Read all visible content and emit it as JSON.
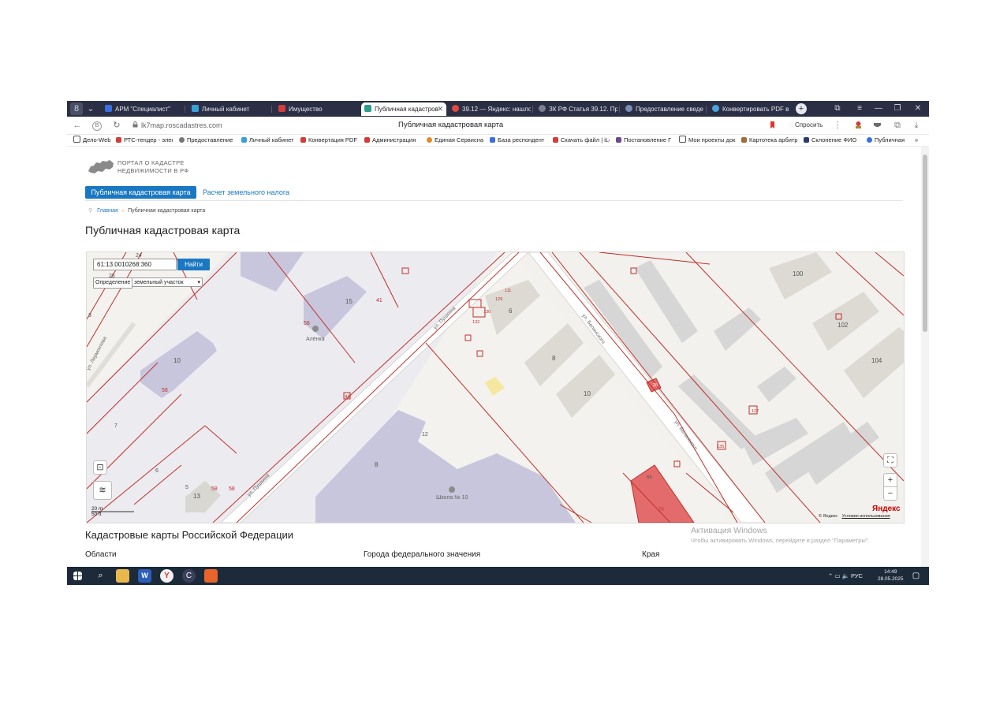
{
  "browser": {
    "tabs": [
      {
        "label": "АРМ \"Специалист\"",
        "color": "#3b6fe0"
      },
      {
        "label": "Личный кабинет",
        "color": "#3aa0d8"
      },
      {
        "label": "Имущество",
        "color": "#d23c3c"
      },
      {
        "label": "Публичная кадастров",
        "color": "#2a9d8f"
      },
      {
        "label": "39.12 — Яндекс: нашло",
        "color": "#e04b3b"
      },
      {
        "label": "ЗК РФ Статья 39.12. Про",
        "color": "#7a7f90"
      },
      {
        "label": "Предоставление сведе",
        "color": "#7a8bb5"
      },
      {
        "label": "Конвертировать PDF в",
        "color": "#4aa3df"
      }
    ],
    "active_tab_index": 3,
    "url": "lk7map.roscadastres.com",
    "page_title": "Публичная кадастровая карта",
    "ask_label": "Спросить",
    "bookmarks": [
      "Дело-Web",
      "РТС-тендер - элек",
      "Предоставление",
      "Личный кабинет",
      "Конвертация PDF",
      "Администрация",
      "Единая Сервисна",
      "База респондент",
      "Скачать файл | iLo",
      "Постановление Г",
      "Мои проекты док",
      "Картотека арбитр",
      "Склонение ФИО",
      "Публичная"
    ],
    "bookmarks_more": "»"
  },
  "portal": {
    "logo_text_line1": "ПОРТАЛ О КАДАСТРЕ",
    "logo_text_line2": "НЕДВИЖИМОСТИ В РФ",
    "nav_active": "Публичная кадастровая карта",
    "nav_second": "Расчет земельного налога",
    "breadcrumb_home": "Главная",
    "breadcrumb_current": "Публичная кадастровая карта",
    "title": "Публичная кадастровая карта"
  },
  "map": {
    "search_value": "61:13.0010268:360",
    "find_button": "Найти",
    "definition_label": "Определение",
    "definition_value": "земельный участок",
    "street_pushkina": "ул. Пушкина",
    "street_belinskogo": "ул. Белинского",
    "street_lermontova": "ул. Лермонтова",
    "poi_alenka": "Алёнка",
    "poi_school": "Школа № 10",
    "scale_m": "20 m",
    "scale_ft": "50 ft",
    "copyright": "© Яндекс",
    "terms": "Условия использования",
    "ya_logo": "Яндекс",
    "labels": {
      "n24": "24",
      "n25": "25",
      "n3": "3",
      "n15": "15",
      "n41": "41",
      "n58a": "58",
      "n10a": "10",
      "n58b": "58",
      "n7": "7",
      "n6": "6",
      "n5": "5",
      "n13": "13",
      "n58c": "58",
      "n58d": "58",
      "n44": "44",
      "n8a": "8",
      "n12": "12",
      "n111": "111",
      "n129": "129",
      "n130": "130",
      "n132": "132",
      "n6b": "6",
      "n8b": "8",
      "n10b": "10",
      "n100": "100",
      "n102": "102",
      "n104": "104",
      "n127": "127",
      "n135": "135",
      "n25b": "25",
      "n69": "69",
      "n70": "70"
    }
  },
  "below": {
    "heading": "Кадастровые карты Российской Федерации",
    "col1": "Области",
    "col2": "Города федерального значения",
    "col3": "Края"
  },
  "activation": {
    "line1": "Активация Windows",
    "line2": "Чтобы активировать Windows, перейдите в раздел \"Параметры\"."
  },
  "taskbar": {
    "lang": "РУС",
    "time": "14:49",
    "date": "28.05.2025"
  },
  "colors": {
    "accent": "#1a78c2",
    "parcel_line": "#c0302a",
    "highlight_parcel": "#e36b6b",
    "selected_parcel": "#f5e7a0"
  }
}
